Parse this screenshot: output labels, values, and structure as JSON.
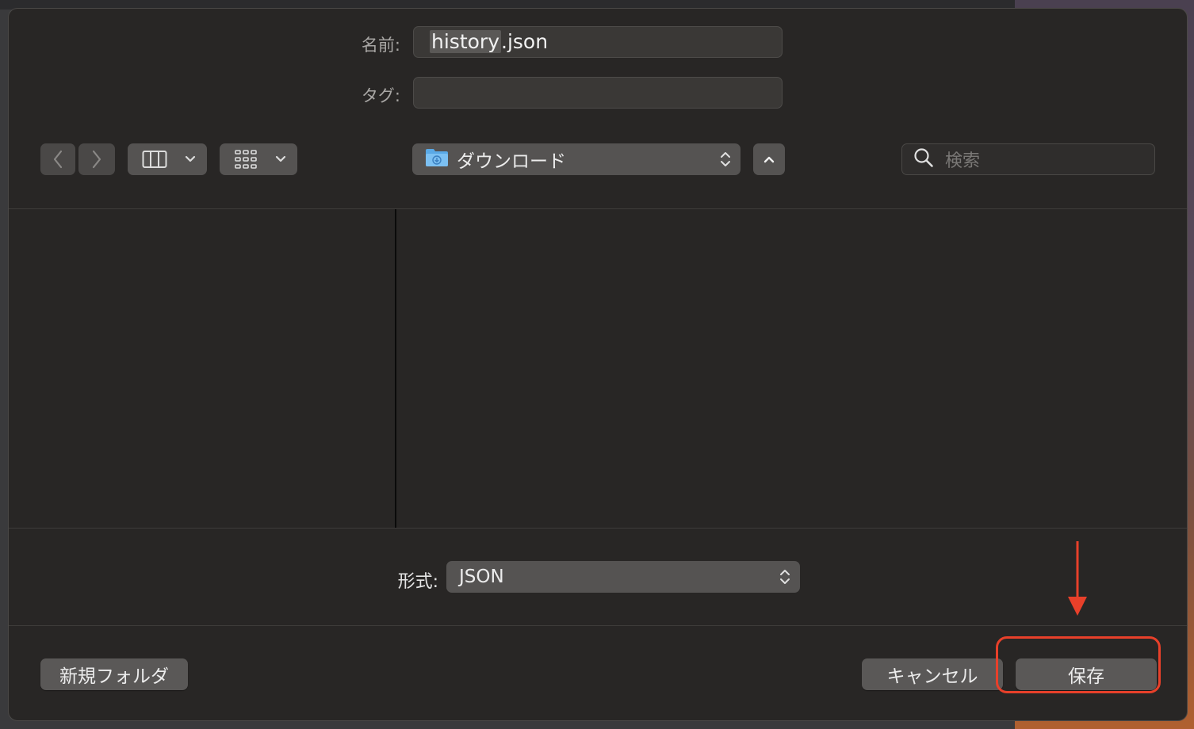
{
  "dialog": {
    "name_label": "名前:",
    "name_value": "history.json",
    "name_selected_part": "history",
    "name_rest_part": ".json",
    "tags_label": "タグ:",
    "tags_value": ""
  },
  "toolbar": {
    "back_icon": "chevron-left-icon",
    "forward_icon": "chevron-right-icon",
    "view_mode_icon": "column-view-icon",
    "group_icon": "grid-view-icon",
    "location": "ダウンロード",
    "location_icon": "downloads-folder-icon",
    "search_placeholder": "検索"
  },
  "format": {
    "label": "形式:",
    "selected": "JSON"
  },
  "buttons": {
    "new_folder": "新規フォルダ",
    "cancel": "キャンセル",
    "save": "保存"
  },
  "annotation": {
    "color": "#e8402a"
  }
}
